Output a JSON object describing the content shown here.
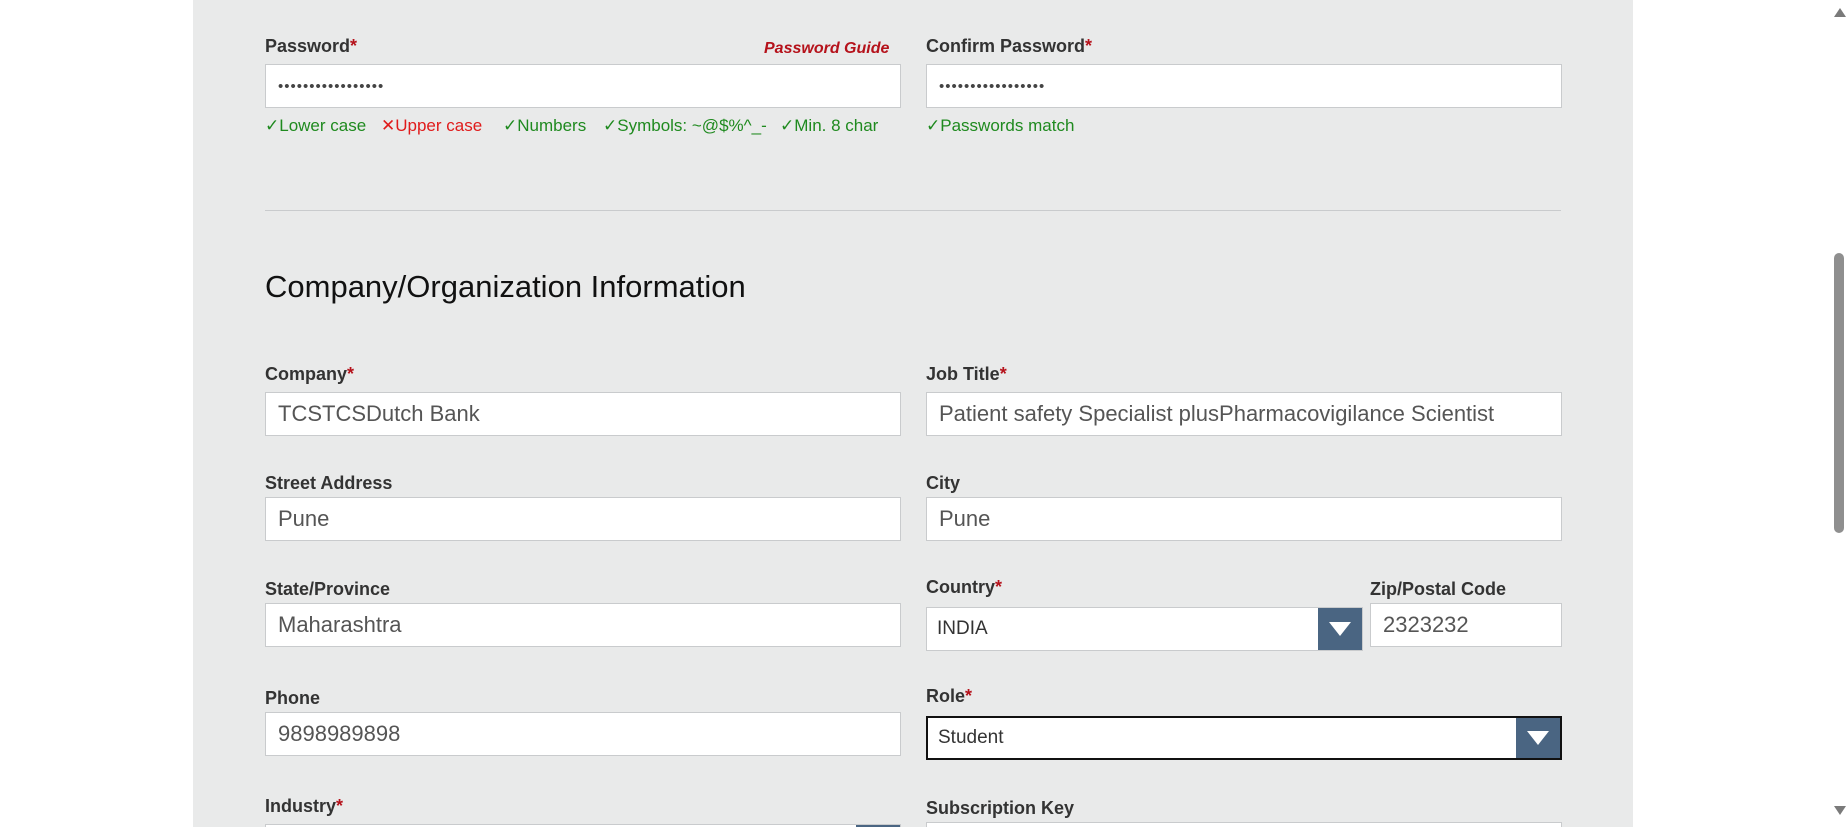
{
  "password": {
    "label": "Password",
    "required_mark": "*",
    "guide_link": "Password Guide",
    "value": "•••••••••••••••••",
    "checks": [
      {
        "mark": "✓",
        "text": "Lower case",
        "ok": true
      },
      {
        "mark": "✕",
        "text": "Upper case",
        "ok": false
      },
      {
        "mark": "✓",
        "text": "Numbers",
        "ok": true
      },
      {
        "mark": "✓",
        "text": "Symbols: ~@$%^_-",
        "ok": true
      },
      {
        "mark": "✓",
        "text": "Min. 8 char",
        "ok": true
      }
    ]
  },
  "confirm_password": {
    "label": "Confirm Password",
    "required_mark": "*",
    "value": "•••••••••••••••••",
    "match_mark": "✓",
    "match_text": "Passwords match"
  },
  "section_title": "Company/Organization Information",
  "company": {
    "label": "Company",
    "required_mark": "*",
    "value": "TCSTCSDutch Bank"
  },
  "job_title": {
    "label": "Job Title",
    "required_mark": "*",
    "value": "Patient safety Specialist plusPharmacovigilance Scientist"
  },
  "street_address": {
    "label": "Street Address",
    "value": "Pune"
  },
  "city": {
    "label": "City",
    "value": "Pune"
  },
  "state": {
    "label": "State/Province",
    "value": "Maharashtra"
  },
  "country": {
    "label": "Country",
    "required_mark": "*",
    "value": "INDIA"
  },
  "zip": {
    "label": "Zip/Postal Code",
    "value": "2323232"
  },
  "phone": {
    "label": "Phone",
    "value": "9898989898"
  },
  "role": {
    "label": "Role",
    "required_mark": "*",
    "value": "Student"
  },
  "industry": {
    "label": "Industry",
    "required_mark": "*"
  },
  "subscription_key": {
    "label": "Subscription Key"
  },
  "colors": {
    "required": "#b5121b",
    "ok": "#1f8a1f",
    "error": "#e01b1b",
    "select_arrow_bg": "#4a6582",
    "panel_bg": "#e9eaea"
  },
  "icons": {
    "select_arrow": "triangle-down-icon",
    "scroll_up": "scroll-up-arrow-icon",
    "scroll_down": "scroll-down-arrow-icon"
  }
}
